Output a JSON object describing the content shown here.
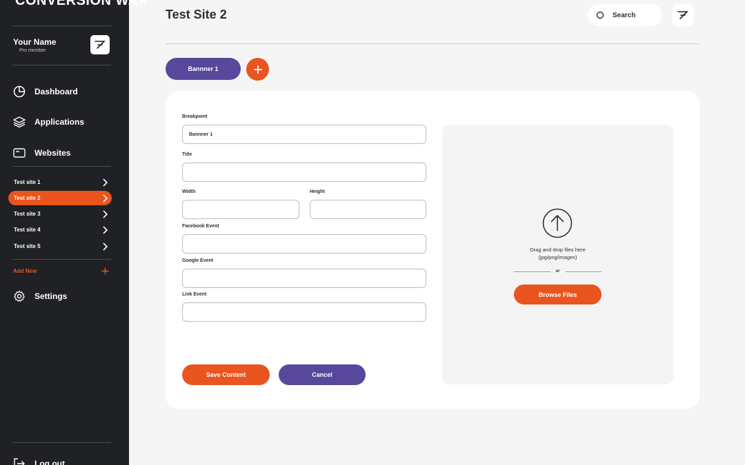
{
  "brand": "CONVERSION WAX",
  "user": {
    "name": "Your Name",
    "role": "Pro member"
  },
  "nav": {
    "dashboard": "Dashboard",
    "applications": "Applications",
    "websites": "Websites",
    "settings": "Settings",
    "logout": "Log out"
  },
  "sites": [
    {
      "label": "Test site 1"
    },
    {
      "label": "Test site 2",
      "active": true
    },
    {
      "label": "Test site 3"
    },
    {
      "label": "Test site 4"
    },
    {
      "label": "Test site 5"
    }
  ],
  "add_new": "Add New",
  "header": {
    "title": "Test Site 2",
    "search_label": "Search"
  },
  "tabs": {
    "banner": "Bannner 1"
  },
  "form": {
    "breakpoint_label": "Breakpoint",
    "breakpoint_value": "Bannner 1",
    "title_label": "Title",
    "title_value": "",
    "width_label": "Width",
    "width_value": "",
    "height_label": "Height",
    "height_value": "",
    "facebook_label": "Facebook Event",
    "facebook_value": "",
    "google_label": "Google Event",
    "google_value": "",
    "link_label": "Link Event",
    "link_value": "",
    "save_label": "Save Content",
    "cancel_label": "Cancel"
  },
  "dropzone": {
    "line1": "Drag and drop files here",
    "line2": "(jpg/png/images)",
    "or": "or",
    "browse_label": "Browse Files"
  },
  "colors": {
    "sidebar": "#1f2124",
    "accent": "#e9541f",
    "purple": "#58489c",
    "background": "#f5f5f5"
  },
  "icons": [
    "brand-logo-icon",
    "pie-chart-icon",
    "layers-icon",
    "browser-window-icon",
    "chevron-right-icon",
    "plus-icon",
    "gear-icon",
    "logout-icon",
    "search-icon",
    "upload-arrow-icon"
  ]
}
